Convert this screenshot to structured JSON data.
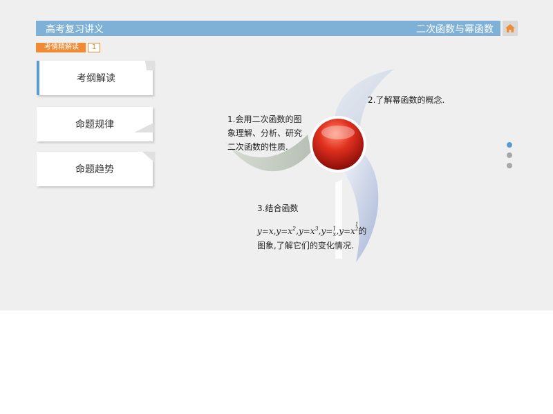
{
  "header": {
    "left_title": "高考复习讲义",
    "right_title": "二次函数与幂函数",
    "home_icon": "home-icon"
  },
  "section_tag": {
    "label": "考情精解读",
    "number": "1"
  },
  "nav": [
    {
      "label": "考纲解读"
    },
    {
      "label": "命题规律"
    },
    {
      "label": "命题趋势"
    }
  ],
  "points": {
    "p1_lines": [
      "1.会用二次函数的图",
      "象理解、分析、研究",
      "二次函数的性质."
    ],
    "p2": "2.了解幂函数的概念.",
    "p3_title": "3.结合函数",
    "p3_formula": "y=x,y=x²,y=x³,y=1/x,y=x^(1/2)的",
    "p3_formula_suffix": "的",
    "p3_end": "图象,了解它们的变化情况."
  },
  "pagination": {
    "count": 3,
    "active": 1
  },
  "colors": {
    "header_blue": "#7fb1d6",
    "orange": "#ef8b34",
    "accent_blue": "#5b9bd5",
    "sphere_red": "#d42a1c"
  }
}
